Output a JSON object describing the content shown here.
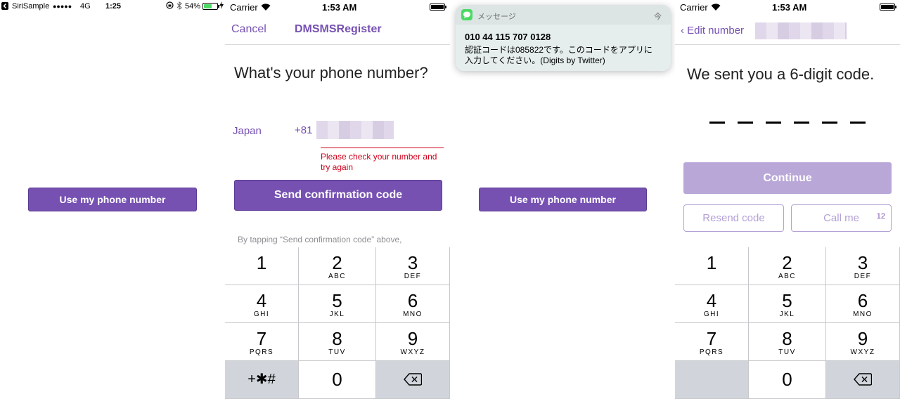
{
  "panel1": {
    "status": {
      "app": "SiriSample",
      "signal": "●●●●●",
      "network": "4G",
      "time": "1:25",
      "battery": "54%"
    },
    "button_label": "Use my phone number"
  },
  "panel2": {
    "status": {
      "carrier": "Carrier",
      "time": "1:53 AM"
    },
    "cancel": "Cancel",
    "title": "DMSMSRegister",
    "heading": "What's your phone number?",
    "country": "Japan",
    "code": "+81",
    "error": "Please check your number and try again",
    "send_button": "Send confirmation code",
    "disclaimer": "By tapping “Send confirmation code” above,"
  },
  "panel3": {
    "notification": {
      "app": "メッセージ",
      "time": "今",
      "sender": "010 44 115 707 0128",
      "body_line1": "認証コードは085822です。このコードをアプリに",
      "body_line2": "入力してください。(Digits by Twitter)"
    },
    "button_label": "Use my phone number"
  },
  "panel4": {
    "status": {
      "carrier": "Carrier",
      "time": "1:53 AM"
    },
    "back": "‹ Edit number",
    "heading": "We sent you a 6-digit code.",
    "continue_button": "Continue",
    "resend_button": "Resend code",
    "call_button": "Call me",
    "call_countdown": "12"
  },
  "keypad": {
    "keys": [
      {
        "num": "1",
        "letters": ""
      },
      {
        "num": "2",
        "letters": "ABC"
      },
      {
        "num": "3",
        "letters": "DEF"
      },
      {
        "num": "4",
        "letters": "GHI"
      },
      {
        "num": "5",
        "letters": "JKL"
      },
      {
        "num": "6",
        "letters": "MNO"
      },
      {
        "num": "7",
        "letters": "PQRS"
      },
      {
        "num": "8",
        "letters": "TUV"
      },
      {
        "num": "9",
        "letters": "WXYZ"
      }
    ],
    "symbols": "+✱#",
    "zero": "0",
    "delete_icon": "backspace-icon"
  },
  "colors": {
    "accent": "#7651b2",
    "accent_light": "#b3a0d6",
    "error": "#d0021b",
    "key_dark": "#d1d5db"
  }
}
